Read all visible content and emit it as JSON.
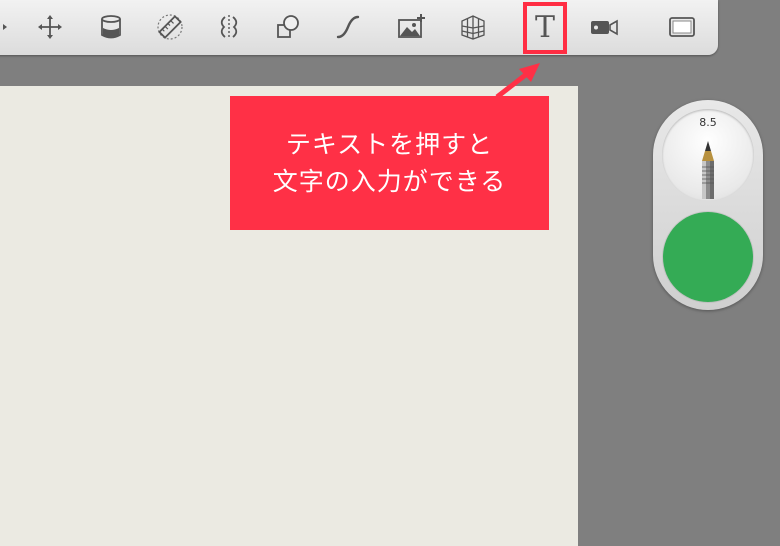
{
  "toolbar": {
    "tools": [
      {
        "name": "transform-tool",
        "icon": "move-arrows-icon"
      },
      {
        "name": "fill-tool",
        "icon": "paint-bucket-icon"
      },
      {
        "name": "ruler-tool",
        "icon": "ruler-icon"
      },
      {
        "name": "symmetry-tool",
        "icon": "symmetry-icon"
      },
      {
        "name": "shape-tool",
        "icon": "shapes-icon"
      },
      {
        "name": "curve-tool",
        "icon": "curve-icon"
      },
      {
        "name": "image-tool",
        "icon": "add-image-icon"
      },
      {
        "name": "perspective-tool",
        "icon": "perspective-grid-icon"
      },
      {
        "name": "text-tool",
        "icon": "text-icon",
        "label": "T",
        "selected": true
      },
      {
        "name": "record-tool",
        "icon": "video-camera-icon"
      },
      {
        "name": "fullscreen-tool",
        "icon": "fullscreen-icon"
      }
    ]
  },
  "callout": {
    "line1": "テキストを押すと",
    "line2": "文字の入力ができる",
    "color": "#ff3046"
  },
  "palette": {
    "brush_size": "8.5",
    "brush_icon": "pencil-icon",
    "current_color": "#34ab55"
  },
  "canvas": {
    "color": "#ebeae2"
  }
}
